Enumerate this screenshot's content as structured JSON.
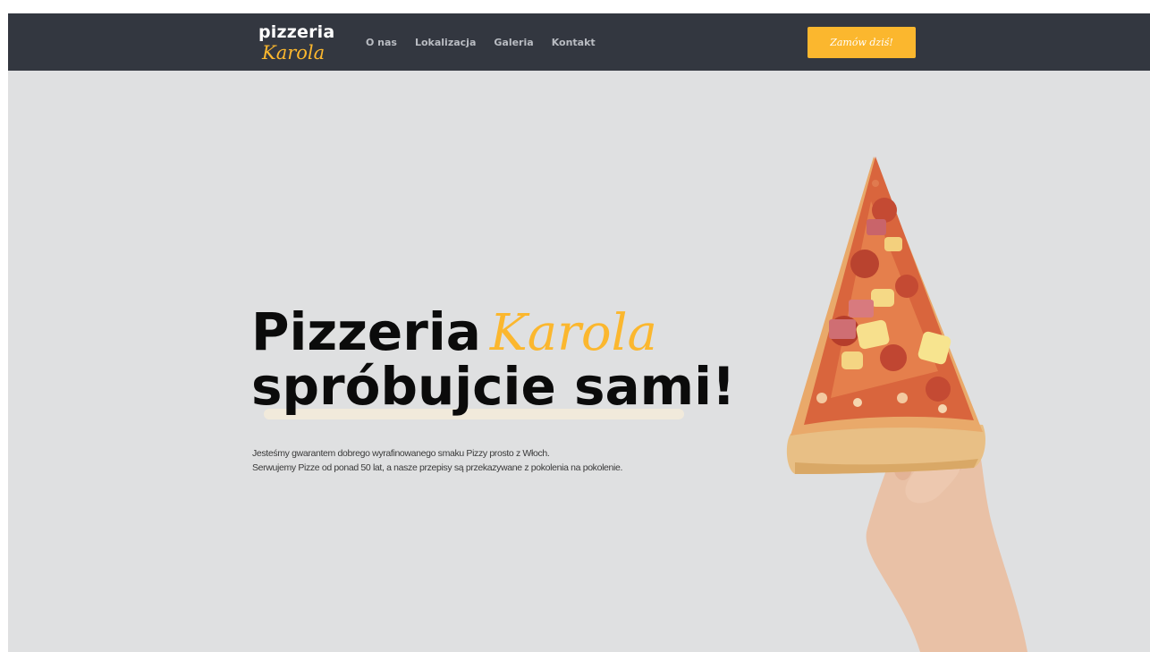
{
  "brand": {
    "name_top": "pizzeria",
    "name_bottom": "Karola",
    "accent_color": "#fbb72e",
    "nav_bg": "#333740"
  },
  "nav": {
    "links": [
      "O nas",
      "Lokalizacja",
      "Galeria",
      "Kontakt"
    ],
    "cta_label": "Zamów dziś!"
  },
  "hero": {
    "title_word": "Pizzeria",
    "title_accent": "Karola",
    "title_line2": "spróbujcie sami!",
    "desc_line1": "Jesteśmy gwarantem dobrego wyrafinowanego smaku Pizzy prosto z Włoch.",
    "desc_line2": "Serwujemy Pizze od ponad 50 lat, a nasze przepisy są przekazywane z pokolenia na pokolenie.",
    "image_icon": "pizza-slice-in-hand-image",
    "bg_color": "#dfe0e1"
  }
}
